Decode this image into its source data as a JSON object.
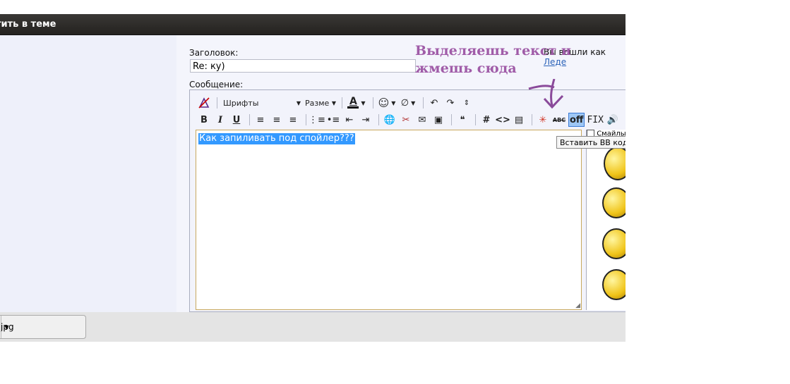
{
  "window": {
    "title": "тить в теме"
  },
  "form": {
    "subject_label": "Заголовок:",
    "subject_value": "Re: ку)",
    "logged_in_prefix": "Вы вошли как",
    "logged_in_user": "Леде",
    "message_label": "Сообщение:",
    "message_selected_text": "Как запиливать под спойлер???"
  },
  "toolbar": {
    "font_select": "Шрифты",
    "size_select": "Разме",
    "off_label": "off",
    "fix_label": "FIX",
    "abc_label": "ABC",
    "hash_label": "#",
    "code_label": "<>",
    "tooltip": "Вставить BB код [off]"
  },
  "sidebar": {
    "smiles_label": "Смайлы"
  },
  "footer": {
    "file_label": "jpg"
  },
  "annotation": {
    "line1": "Выделяешь текст и",
    "line2": "жмешь сюда"
  },
  "colors": {
    "annotation": "#a05ca8",
    "selection": "#3399ff",
    "titlebar": "#2b2926",
    "link": "#2a62b8"
  }
}
